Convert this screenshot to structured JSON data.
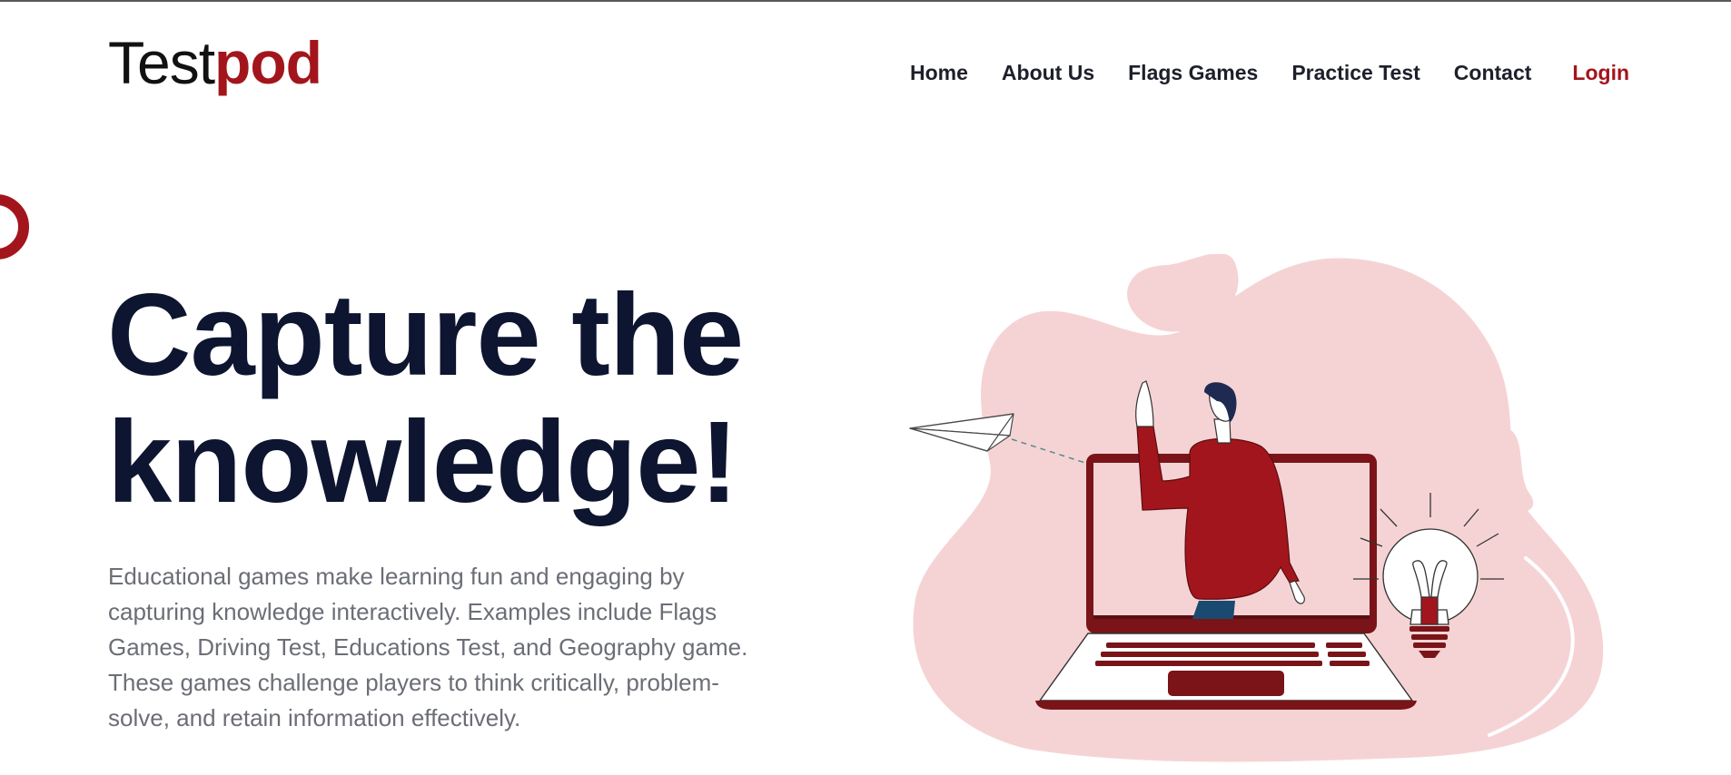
{
  "header": {
    "logo": {
      "part1": "Test",
      "part2": "pod"
    },
    "nav": [
      {
        "label": "Home"
      },
      {
        "label": "About Us"
      },
      {
        "label": "Flags Games"
      },
      {
        "label": "Practice Test"
      },
      {
        "label": "Contact"
      },
      {
        "label": "Login"
      }
    ]
  },
  "hero": {
    "title_line1": "Capture the",
    "title_line2": "knowledge!",
    "description": "Educational games make learning fun and engaging by capturing knowledge interactively. Examples include Flags Games, Driving Test, Educations Test, and Geography game. These games challenge players to think critically, problem-solve, and retain information effectively."
  },
  "illustration": {
    "icons": [
      "paper-plane-icon",
      "person-icon",
      "laptop-icon",
      "lightbulb-icon"
    ]
  },
  "colors": {
    "brand_red": "#a3151c",
    "dark_navy": "#0d1530",
    "blob_pink": "#f5d3d4",
    "body_text": "#6b6e76"
  }
}
